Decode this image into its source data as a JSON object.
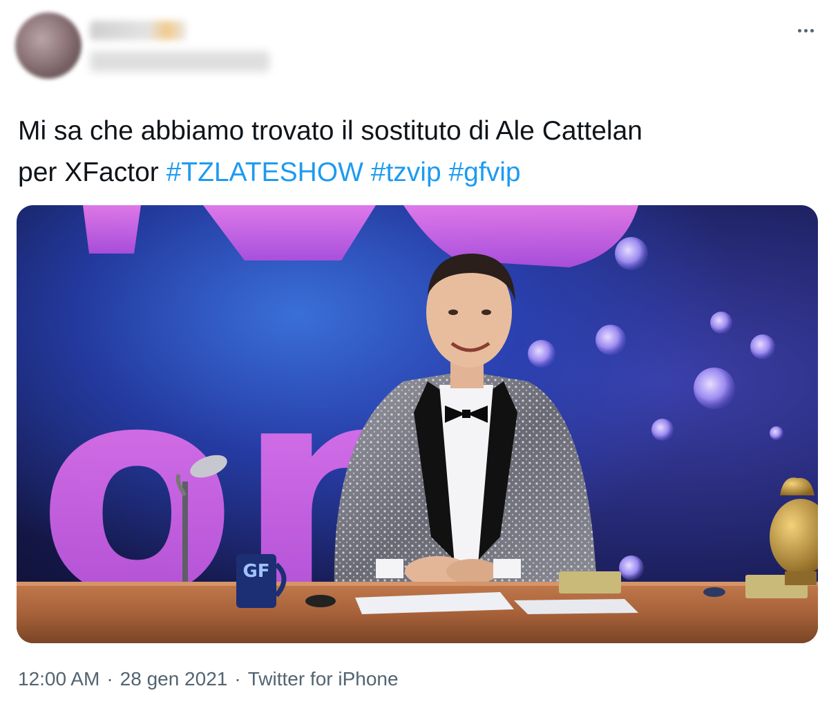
{
  "header": {
    "more_icon": "more-horizontal-icon"
  },
  "tweet": {
    "text_line1": "Mi sa che abbiamo trovato il sostituto di Ale Cattelan",
    "text_line2": "per XFactor",
    "hashtags": [
      "#TZLATESHOW",
      "#tzvip",
      "#gfvip"
    ]
  },
  "media": {
    "mug_logo": "GF",
    "backdrop_letters": "on"
  },
  "footer": {
    "time": "12:00 AM",
    "separator": "·",
    "date": "28 gen 2021",
    "source": "Twitter for iPhone"
  },
  "colors": {
    "text": "#0f1419",
    "link": "#1d9bf0",
    "meta": "#536471"
  }
}
